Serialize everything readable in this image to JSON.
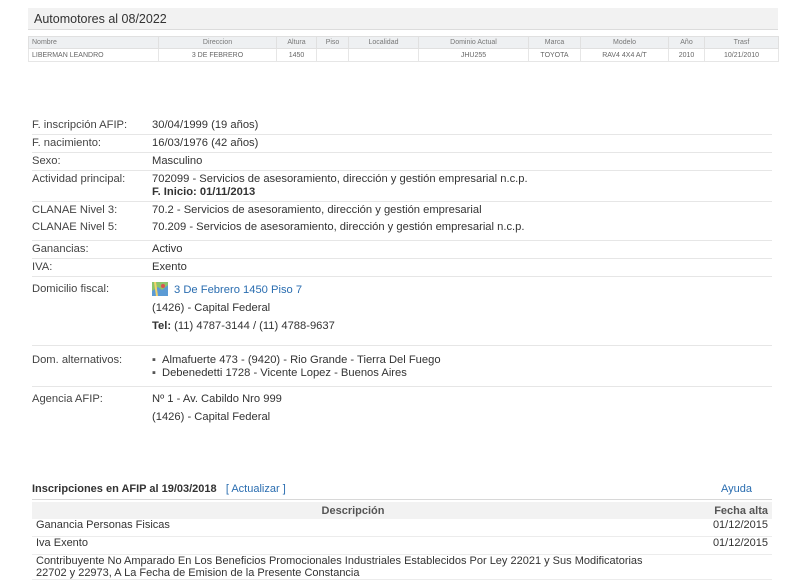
{
  "vehicles": {
    "title": "Automotores al 08/2022",
    "columns": [
      "Nombre",
      "Direccion",
      "Altura",
      "Piso",
      "Localidad",
      "Dominio Actual",
      "Marca",
      "Modelo",
      "Año",
      "Trasf"
    ],
    "rows": [
      [
        "LIBERMAN LEANDRO",
        "3 DE FEBRERO",
        "1450",
        "",
        "",
        "JHU255",
        "TOYOTA",
        "RAV4 4X4 A/T",
        "2010",
        "10/21/2010"
      ]
    ]
  },
  "info": {
    "inscripcion": {
      "label": "F. inscripción AFIP:",
      "value": "30/04/1999 (19 años)"
    },
    "nacimiento": {
      "label": "F. nacimiento:",
      "value": "16/03/1976 (42 años)"
    },
    "sexo": {
      "label": "Sexo:",
      "value": "Masculino"
    },
    "actividad": {
      "label": "Actividad principal:",
      "value": "702099 - Servicios de asesoramiento, dirección y gestión empresarial n.c.p.",
      "inicio_label": "F. Inicio:",
      "inicio_value": "01/11/2013"
    },
    "clanae3": {
      "label": "CLANAE Nivel 3:",
      "value": "70.2 - Servicios de asesoramiento, dirección y gestión empresarial"
    },
    "clanae5": {
      "label": "CLANAE Nivel 5:",
      "value": "70.209 - Servicios de asesoramiento, dirección y gestión empresarial n.c.p."
    },
    "ganancias": {
      "label": "Ganancias:",
      "value": "Activo"
    },
    "iva": {
      "label": "IVA:",
      "value": "Exento"
    },
    "domicilio": {
      "label": "Domicilio fiscal:",
      "address": "3 De Febrero 1450 Piso 7",
      "city": "(1426) - Capital Federal",
      "tel_label": "Tel:",
      "tel_value": "(11) 4787-3144 / (11) 4788-9637"
    },
    "alternativos": {
      "label": "Dom. alternativos:",
      "items": [
        "Almafuerte 473 - (9420) - Rio Grande - Tierra Del Fuego",
        "Debenedetti 1728 - Vicente Lopez - Buenos Aires"
      ]
    },
    "agencia": {
      "label": "Agencia AFIP:",
      "value": "Nº 1 - Av. Cabildo Nro 999",
      "city": "(1426) - Capital Federal"
    }
  },
  "afip": {
    "title": "Inscripciones en AFIP al 19/03/2018",
    "action": "Actualizar",
    "help": "Ayuda",
    "col_desc": "Descripción",
    "col_date": "Fecha alta",
    "rows": [
      {
        "desc": "Ganancia Personas Fisicas",
        "date": "01/12/2015"
      },
      {
        "desc": "Iva Exento",
        "date": "01/12/2015"
      },
      {
        "desc": "Contribuyente No Amparado En Los Beneficios Promocionales Industriales Establecidos Por Ley 22021 y Sus Modificatorias 22702 y 22973, A La Fecha de Emision de la Presente Constancia",
        "date": ""
      }
    ]
  },
  "colors": {
    "link": "#2a6db0",
    "header_bg": "#f2f2f2"
  }
}
